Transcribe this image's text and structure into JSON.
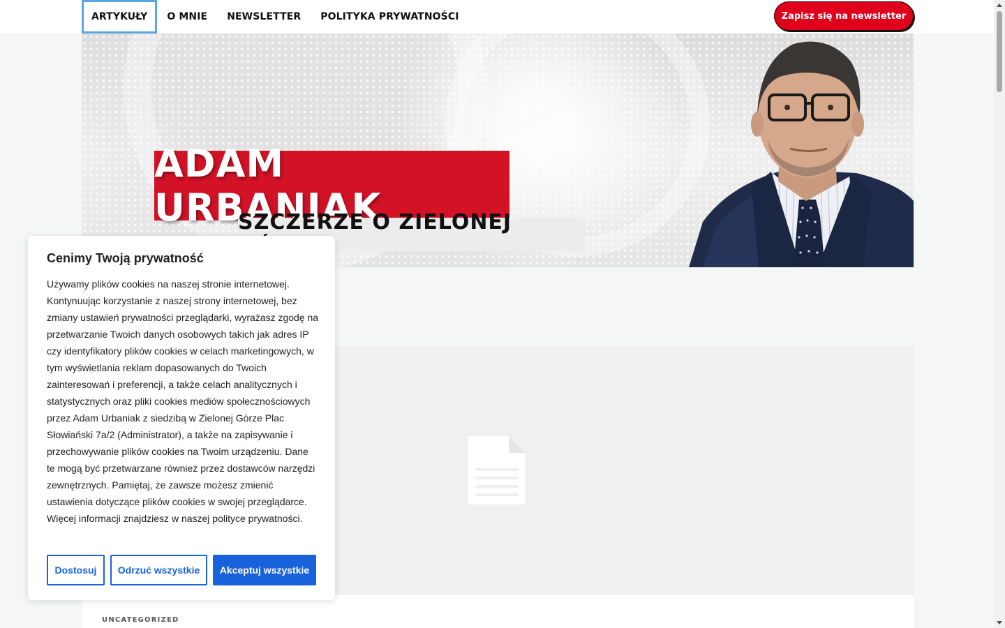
{
  "nav": {
    "items": [
      {
        "label": "ARTYKUŁY",
        "active": true
      },
      {
        "label": "O MNIE",
        "active": false
      },
      {
        "label": "NEWSLETTER",
        "active": false
      },
      {
        "label": "POLITYKA PRYWATNOŚCI",
        "active": false
      }
    ],
    "cta_label": "Zapisz się na newsletter",
    "cta_color": "#e0001b"
  },
  "banner": {
    "name": "ADAM URBANIAK",
    "tagline": "SZCZERZE O ZIELONEJ GÓRZE",
    "name_bg_color": "#d31226",
    "portrait_icon": "portrait-image"
  },
  "article": {
    "placeholder_icon": "document-icon",
    "category": "UNCATEGORIZED"
  },
  "cookie_banner": {
    "title": "Cenimy Twoją prywatność",
    "body": "Używamy plików cookies na naszej stronie internetowej. Kontynuując korzystanie z naszej strony internetowej, bez zmiany ustawień prywatności przeglądarki, wyrażasz zgodę na przetwarzanie Twoich danych osobowych takich jak adres IP czy identyfikatory plików cookies w celach marketingowych, w tym wyświetlania reklam dopasowanych do Twoich zainteresowań i preferencji, a także celach analitycznych i statystycznych oraz pliki cookies mediów społecznościowych przez Adam Urbaniak z siedzibą w Zielonej Górze Plac Słowiański 7a/2 (Administrator), a także na zapisywanie i przechowywanie plików cookies na Twoim urządzeniu. Dane te mogą być przetwarzane również przez dostawców narzędzi zewnętrznych. Pamiętaj, że zawsze możesz zmienić ustawienia dotyczące plików cookies w swojej przeglądarce. Więcej informacji znajdziesz w naszej polityce prywatności.",
    "buttons": {
      "customize": "Dostosuj",
      "reject": "Odrzuć wszystkie",
      "accept": "Akceptuj wszystkie"
    },
    "accent_color": "#1863dc"
  }
}
